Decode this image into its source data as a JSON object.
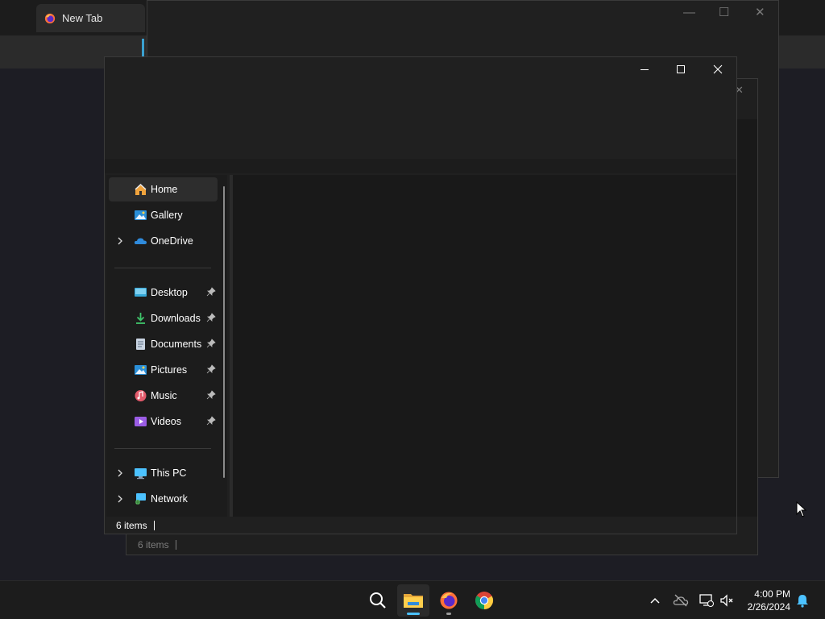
{
  "browser": {
    "tab_title": "New Tab"
  },
  "explorer_back": {
    "status_items": "6 items"
  },
  "explorer": {
    "title_controls": {
      "minimize": "minimize",
      "maximize": "maximize",
      "close": "close"
    },
    "nav": {
      "top_items": [
        {
          "label": "Home",
          "icon": "home-icon"
        },
        {
          "label": "Gallery",
          "icon": "gallery-icon"
        },
        {
          "label": "OneDrive",
          "icon": "cloud-icon"
        }
      ],
      "quick_access": [
        {
          "label": "Desktop",
          "icon": "desktop-icon"
        },
        {
          "label": "Downloads",
          "icon": "download-icon"
        },
        {
          "label": "Documents",
          "icon": "document-icon"
        },
        {
          "label": "Pictures",
          "icon": "pictures-icon"
        },
        {
          "label": "Music",
          "icon": "music-icon"
        },
        {
          "label": "Videos",
          "icon": "videos-icon"
        }
      ],
      "bottom_items": [
        {
          "label": "This PC",
          "icon": "pc-icon"
        },
        {
          "label": "Network",
          "icon": "network-icon"
        }
      ]
    },
    "status_items": "6 items"
  },
  "taskbar": {
    "apps": [
      "search-icon",
      "file-explorer-icon",
      "firefox-icon",
      "chrome-icon"
    ],
    "clock_time": "4:00 PM",
    "clock_date": "2/26/2024"
  },
  "colors": {
    "accent": "#4cc2ff",
    "window_bg": "#202020",
    "content_bg": "#191919"
  }
}
